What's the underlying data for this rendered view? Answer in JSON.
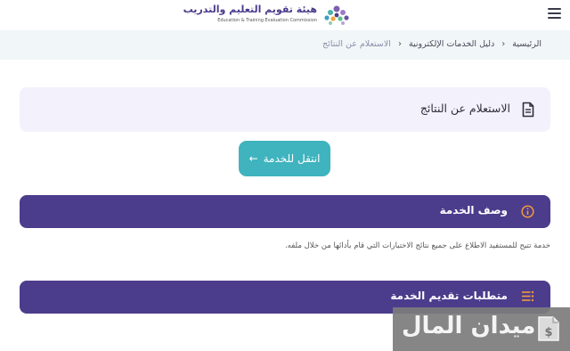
{
  "header": {
    "logo_title": "هيئة تقويم التعليم والتدريب",
    "logo_subtitle": "Education & Training Evaluation Commission"
  },
  "breadcrumb": {
    "items": [
      "الرئيسية",
      "دليل الخدمات الإلكترونية"
    ],
    "current": "الاستعلام عن النتائج"
  },
  "page": {
    "title": "الاستعلام عن النتائج",
    "go_button_label": "انتقل للخدمة"
  },
  "sections": {
    "description_title": "وصف الخدمة",
    "description_text": "خدمة تتيح للمستفيد الاطلاع على جميع نتائج الاختبارات التي قام بأدائها من خلال ملفه.",
    "requirements_title": "متطلبات تقديم الخدمة"
  },
  "watermark": {
    "text": "ميدان المال"
  },
  "colors": {
    "brand_purple": "#4c3c8c",
    "accent_teal": "#3fb3be",
    "info_orange": "#f29b3c"
  }
}
